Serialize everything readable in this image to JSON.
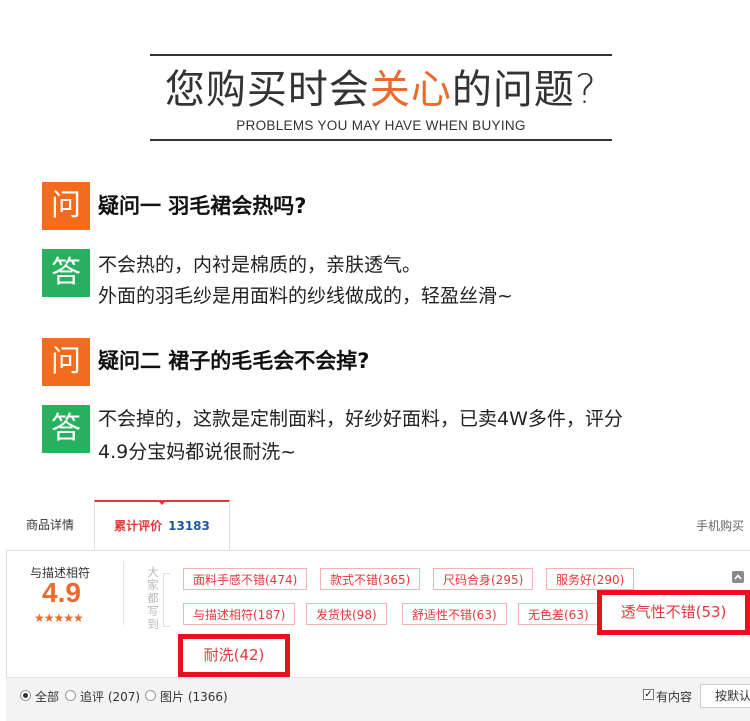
{
  "header": {
    "title_pre": "您购买时会",
    "title_highlight": "关心",
    "title_post": "的问题?",
    "subtitle": "PROBLEMS YOU MAY HAVE WHEN BUYING"
  },
  "faq": [
    {
      "q_badge": "问",
      "question": "疑问一   羽毛裙会热吗?",
      "a_badge": "答",
      "answer_lines": [
        "不会热的，内衬是棉质的，亲肤透气。",
        "外面的羽毛纱是用面料的纱线做成的，轻盈丝滑~"
      ]
    },
    {
      "q_badge": "问",
      "question": "疑问二   裙子的毛毛会不会掉?",
      "a_badge": "答",
      "answer_lines": [
        "不会掉的，这款是定制面料，好纱好面料，已卖4W多件，评分",
        "4.9分宝妈都说很耐洗~"
      ]
    }
  ],
  "reviews": {
    "tabs": {
      "details": "商品详情",
      "reviews_label": "累计评价",
      "reviews_count": "13183",
      "mobile_buy": "手机购买"
    },
    "score": {
      "label": "与描述相符",
      "value": "4.9",
      "stars": "★★★★★"
    },
    "vertical_label": "大家都写到",
    "tags_row1": [
      "面料手感不错(474)",
      "款式不错(365)",
      "尺码合身(295)",
      "服务好(290)"
    ],
    "tags_row2": [
      "与描述相符(187)",
      "发货快(98)",
      "舒适性不错(63)",
      "无色差(63)"
    ],
    "tag_highlight_1": "透气性不错(53)",
    "tag_highlight_2": "耐洗(42)",
    "filters": {
      "all": "全部",
      "followup": "追评 (207)",
      "images": "图片 (1366)",
      "has_content": "有内容",
      "sort": "按默认"
    }
  }
}
